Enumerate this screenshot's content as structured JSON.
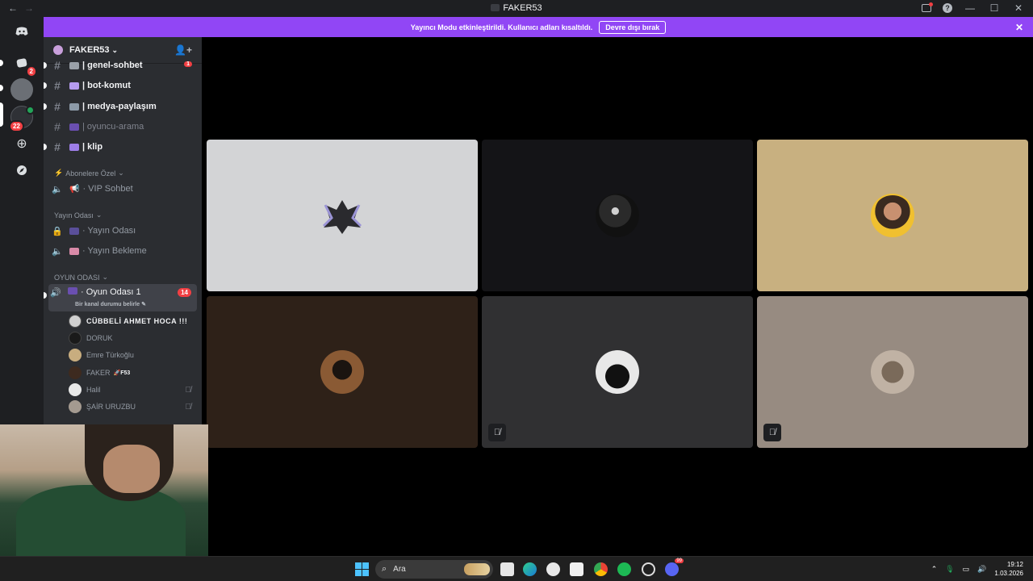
{
  "window": {
    "title": "FAKER53",
    "back": "←",
    "forward": "→"
  },
  "banner": {
    "text": "Yayıncı Modu etkinleştirildi. Kullanıcı adları kısaltıldı.",
    "button": "Devre dışı bırak",
    "close": "✕"
  },
  "servers": {
    "badge_dm": "2",
    "badge_server2": "22"
  },
  "server": {
    "name": "FAKER53",
    "chevron": "⌄",
    "invite_icon": "👤+"
  },
  "channels": {
    "text": [
      {
        "label": "| genel-sohbet",
        "badge": "1"
      },
      {
        "label": "| bot-komut"
      },
      {
        "label": "| medya-paylaşım"
      },
      {
        "label": "| oyuncu-arama"
      },
      {
        "label": "| klip"
      }
    ],
    "cat_abone": "Abonelere Özel",
    "vip": "· VIP Sohbet",
    "cat_yayin": "Yayın Odası",
    "yayin_odasi": "· Yayın Odası",
    "yayin_bekleme": "· Yayın Bekleme",
    "cat_oyun": "OYUN ODASI",
    "oyun_odasi": "· Oyun Odası 1",
    "oyun_badge": "14",
    "status_prompt": "Bir kanal durumu belirle"
  },
  "members": [
    {
      "name": "CÜBBELİ AHMET HOCA !!!"
    },
    {
      "name": "DORUK"
    },
    {
      "name": "Emre Türkoğlu"
    },
    {
      "name": "FAKER",
      "tag": "F53"
    },
    {
      "name": "Halil"
    },
    {
      "name": "ŞAİR URUZBU"
    }
  ],
  "taskbar": {
    "search": "Ara",
    "time": "19:12",
    "date": "1.03.2026",
    "discord_badge": "99"
  },
  "colors": {
    "banner": "#9146f5",
    "sidebar": "#2b2d31",
    "rail": "#1e1f22",
    "speaking": "#23a559",
    "badge": "#f23f43"
  }
}
